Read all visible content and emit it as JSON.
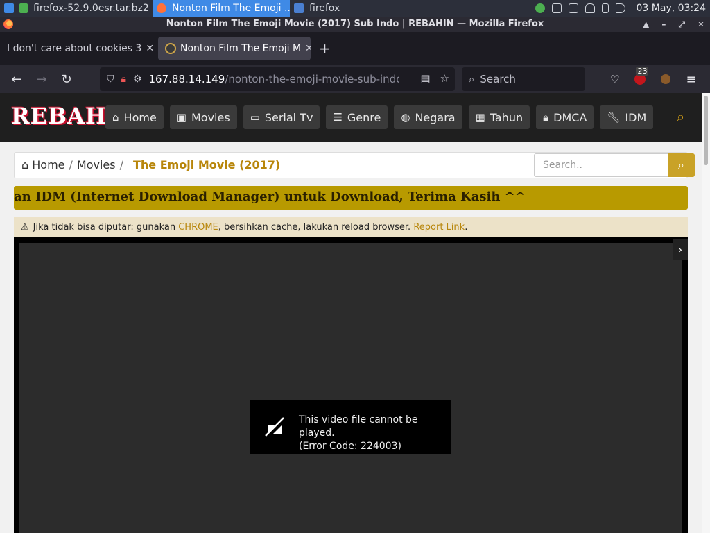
{
  "taskbar": {
    "items": [
      {
        "label": "firefox-52.9.0esr.tar.bz2..."
      },
      {
        "label": "Nonton Film The Emoji ..."
      },
      {
        "label": "firefox"
      }
    ],
    "clock": "03 May, 03:24"
  },
  "window": {
    "title": "Nonton Film The Emoji Movie (2017) Sub Indo | REBAHIN — Mozilla Firefox"
  },
  "tabs": [
    {
      "label": "I don't care about cookies 3"
    },
    {
      "label": "Nonton Film The Emoji M"
    }
  ],
  "urlbar": {
    "host": "167.88.14.149",
    "path": "/nonton-the-emoji-movie-sub-indo/p"
  },
  "searchbar": {
    "placeholder": "Search"
  },
  "extensions": {
    "badge_count": "23"
  },
  "site": {
    "logo": "REBAHIN",
    "menu": [
      {
        "label": "Home",
        "icon": "home-icon"
      },
      {
        "label": "Movies",
        "icon": "film-icon"
      },
      {
        "label": "Serial Tv",
        "icon": "monitor-icon"
      },
      {
        "label": "Genre",
        "icon": "list-icon"
      },
      {
        "label": "Negara",
        "icon": "globe-icon"
      },
      {
        "label": "Tahun",
        "icon": "calendar-icon"
      },
      {
        "label": "DMCA",
        "icon": "lock-icon"
      },
      {
        "label": "IDM",
        "icon": "wrench-icon"
      }
    ],
    "accent": "#c9a227"
  },
  "breadcrumb": {
    "home": "Home",
    "movies": "Movies",
    "current": "The Emoji Movie (2017)",
    "search_placeholder": "Search.."
  },
  "marquee": {
    "text": "an IDM (Internet Download Manager) untuk Download, Terima Kasih ^^"
  },
  "notice": {
    "prefix": "Jika tidak bisa diputar: gunakan",
    "chrome": "CHROME",
    "middle": ", bersihkan cache, lakukan reload browser.",
    "report": "Report Link",
    "suffix": "."
  },
  "player": {
    "error_line1": "This video file cannot be played.",
    "error_line2": "(Error Code: 224003)"
  }
}
